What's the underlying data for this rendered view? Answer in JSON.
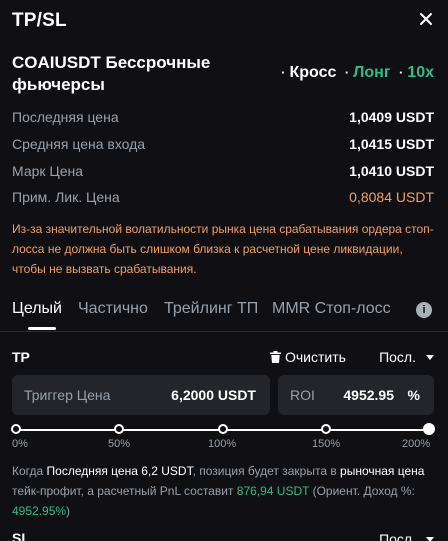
{
  "header": {
    "title": "TP/SL"
  },
  "position": {
    "symbol": "COAIUSDT Бессрочные фьючерсы",
    "margin_mode": "Кросс",
    "side": "Лонг",
    "leverage": "10x",
    "dot": "·"
  },
  "info": [
    {
      "label": "Последняя цена",
      "value": "1,0409 USDT"
    },
    {
      "label": "Средняя цена входа",
      "value": "1,0415 USDT"
    },
    {
      "label": "Марк Цена",
      "value": "1,0410 USDT"
    },
    {
      "label": "Прим. Лик. Цена",
      "value": "0,8084 USDT"
    }
  ],
  "warning": "Из-за значительной волатильности рынка цена срабатывания ордера стоп-лосса не должна быть слишком близка к расчетной цене ликвидации, чтобы не вызвать срабатывания.",
  "tabs": [
    {
      "label": "Целый",
      "active": true
    },
    {
      "label": "Частично",
      "active": false
    },
    {
      "label": "Трейлинг ТП",
      "active": false
    },
    {
      "label": "MMR Стоп-лосс",
      "active": false
    }
  ],
  "tp": {
    "label": "TP",
    "clear_label": "Очистить",
    "price_type": "Посл.",
    "trigger_placeholder": "Триггер Цена",
    "trigger_value": "6,2000",
    "trigger_unit": "USDT",
    "roi_label": "ROI",
    "roi_value": "4952.95",
    "roi_unit": "%",
    "slider_value_pct": 200,
    "slider_ticks": [
      "0%",
      "50%",
      "100%",
      "150%",
      "200%"
    ],
    "summary": {
      "p1": "Когда ",
      "p2": "Последняя цена 6,2 USDT",
      "p3": ", позиция будет закрыта в ",
      "p4": "рыночная цена",
      "p5": " тейк-профит, а расчетный PnL составит ",
      "p6": "876,94 USDT",
      "p7": " (Ориент. Доход %: ",
      "p8": "4952.95%",
      "p9": ")"
    }
  },
  "sl": {
    "label": "SL",
    "price_type": "Посл."
  }
}
